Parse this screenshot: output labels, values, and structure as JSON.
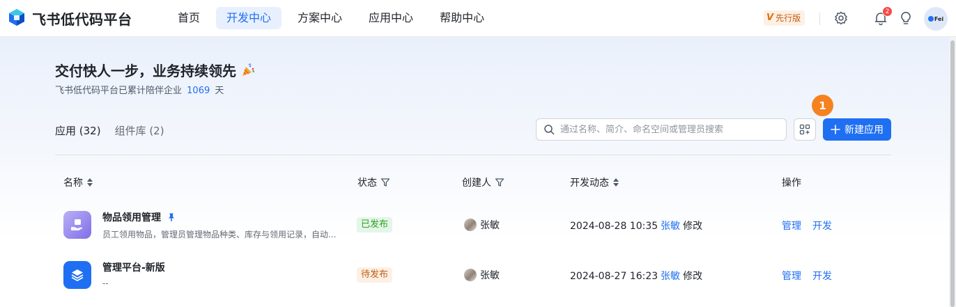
{
  "brand": {
    "name": "飞书低代码平台"
  },
  "nav": {
    "items": [
      "首页",
      "开发中心",
      "方案中心",
      "应用中心",
      "帮助中心"
    ],
    "active_index": 1
  },
  "header": {
    "preview_mark": "V",
    "preview_label": "先行版",
    "notification_count": "2",
    "avatar_text": "Fei"
  },
  "hero": {
    "title": "交付快人一步，业务持续领先",
    "subtitle_prefix": "飞书低代码平台已累计陪伴企业",
    "days": "1069",
    "subtitle_suffix": "天"
  },
  "tabs": [
    {
      "label": "应用 (32)",
      "active": true
    },
    {
      "label": "组件库 (2)",
      "active": false
    }
  ],
  "toolbar": {
    "search_placeholder": "通过名称、简介、命名空间或管理员搜索",
    "new_app_label": "新建应用",
    "step_badge": "1"
  },
  "table": {
    "columns": [
      "名称",
      "状态",
      "创建人",
      "开发动态",
      "操作"
    ],
    "rows": [
      {
        "name": "物品领用管理",
        "pinned": true,
        "description": "员工领用物品，管理员管理物品种类、库存与领用记录，自动...",
        "status": "已发布",
        "status_type": "published",
        "creator": "张敏",
        "activity_time": "2024-08-28 10:35",
        "activity_user": "张敏",
        "activity_action": "修改",
        "actions": [
          "管理",
          "开发"
        ]
      },
      {
        "name": "管理平台-新版",
        "pinned": false,
        "description": "--",
        "status": "待发布",
        "status_type": "pending",
        "creator": "张敏",
        "activity_time": "2024-08-27 16:23",
        "activity_user": "张敏",
        "activity_action": "修改",
        "actions": [
          "管理",
          "开发"
        ]
      }
    ]
  },
  "colors": {
    "accent": "#1f6ff2",
    "published": "#2ea121",
    "pending": "#c35d12",
    "step_badge": "#f5821f"
  }
}
